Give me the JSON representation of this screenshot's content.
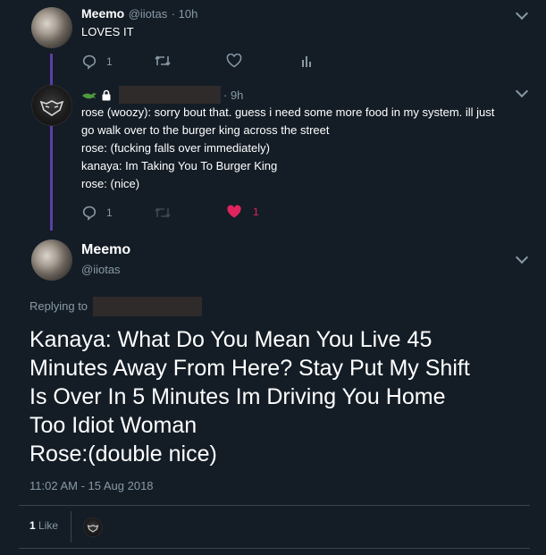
{
  "tweet1": {
    "author": "Meemo",
    "handle": "@iiotas",
    "time": "· 10h",
    "text": "LOVES IT",
    "replies": "1"
  },
  "tweet2": {
    "time": "· 9h",
    "lines": [
      "rose (woozy): sorry bout that. guess i need some more food in my system. ill just",
      "go walk over to the burger king across the street",
      "rose: (fucking falls over immediately)",
      "kanaya: Im Taking You To Burger King",
      "rose: (nice)"
    ],
    "replies": "1",
    "likes": "1"
  },
  "main": {
    "author": "Meemo",
    "handle": "@iiotas",
    "replying_to": "Replying to",
    "lines": [
      "Kanaya: What Do You Mean You Live 45",
      "Minutes Away From Here? Stay Put My Shift",
      "Is Over In 5 Minutes Im Driving You Home",
      "Too Idiot Woman",
      "Rose:(double nice)"
    ],
    "timestamp": "11:02 AM - 15 Aug 2018",
    "like_count": "1",
    "like_label": "Like"
  },
  "colors": {
    "background": "#141d26",
    "muted": "#8899a6",
    "thread": "#5a3ea8",
    "like": "#e0245e"
  }
}
